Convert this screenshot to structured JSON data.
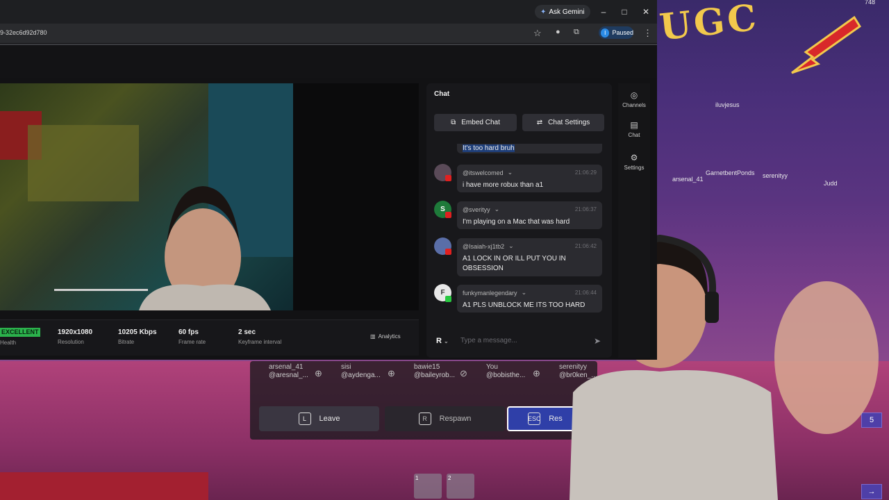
{
  "browser": {
    "gemini_label": "Ask Gemini",
    "url": "9-32ec6d92d780",
    "paused_label": "Paused",
    "paused_initial": "I"
  },
  "stream": {
    "health": {
      "value": "EXCELLENT",
      "label": "Health"
    },
    "stats": [
      {
        "value": "1920x1080",
        "label": "Resolution"
      },
      {
        "value": "10205 Kbps",
        "label": "Bitrate"
      },
      {
        "value": "60 fps",
        "label": "Frame rate"
      },
      {
        "value": "2 sec",
        "label": "Keyframe interval"
      }
    ],
    "analytics_label": "Analytics"
  },
  "chat": {
    "title": "Chat",
    "embed_label": "Embed Chat",
    "settings_label": "Chat Settings",
    "partial_message": "It's too hard bruh",
    "messages": [
      {
        "user": "@itswelcomed",
        "time": "21:06:29",
        "text": "i have more robux than a1",
        "avatar_letter": "",
        "avatar_color": "#5a4a58",
        "platform": "youtube"
      },
      {
        "user": "@sverityy",
        "time": "21:06:37",
        "text": "I'm playing on a Mac that was hard",
        "avatar_letter": "S",
        "avatar_color": "#1e7a3a",
        "platform": "youtube"
      },
      {
        "user": "@Isaiah-xj1tb2",
        "time": "21:06:42",
        "text": "A1 LOCK IN OR ILL PUT YOU IN OBSESSION",
        "avatar_letter": "",
        "avatar_color": "#5a6ea8",
        "platform": "youtube"
      },
      {
        "user": "funkymanlegendary",
        "time": "21:06:44",
        "text": "A1 PLS UNBLOCK ME ITS TOO HARD",
        "avatar_letter": "F",
        "avatar_color": "#e8e8e8",
        "platform": "twitch"
      }
    ],
    "input_placeholder": "Type a message...",
    "platform_letter": "R"
  },
  "rail": {
    "channels": "Channels",
    "chat": "Chat",
    "settings": "Settings"
  },
  "game": {
    "sign_text": "UGC",
    "names": [
      "iluvjesus",
      "GarnetbentPonds",
      "arsenal_41",
      "serenityy",
      "Judd"
    ],
    "players": [
      {
        "name": "arsenal_41",
        "handle": "@aresnal_..."
      },
      {
        "name": "sisi",
        "handle": "@aydenga..."
      },
      {
        "name": "bawie15",
        "handle": "@baileyrob..."
      },
      {
        "name": "You",
        "handle": "@bobisthe..."
      },
      {
        "name": "serenityy",
        "handle": "@br0ken_..."
      }
    ],
    "buttons": {
      "leave": {
        "key": "L",
        "label": "Leave"
      },
      "respawn": {
        "key": "R",
        "label": "Respawn"
      },
      "res": {
        "key": "ESC",
        "label": "Res"
      }
    },
    "hotbar": [
      "1",
      "2"
    ],
    "side_number": "5",
    "top_count": "748"
  }
}
